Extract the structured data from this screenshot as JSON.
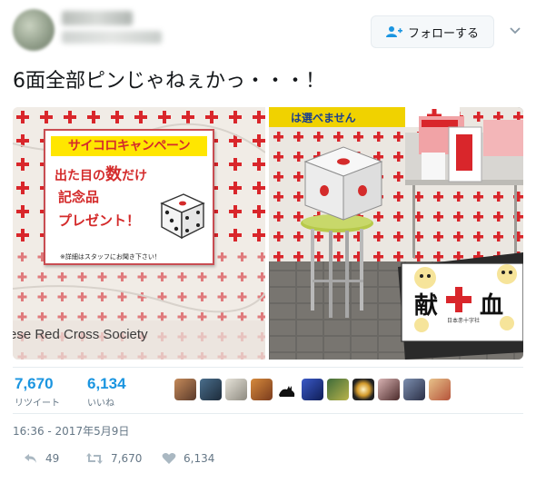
{
  "header": {
    "follow_label": "フォローする"
  },
  "tweet": {
    "text": "6面全部ピンじゃねぇかっ・・・！"
  },
  "media": {
    "left_photo": {
      "sign_title": "サイコロキャンペーン",
      "sign_line1_a": "出た目の",
      "sign_line1_b": "数",
      "sign_line1_c": "だけ",
      "sign_line2": "記念品",
      "sign_line3": "プレゼント！",
      "sign_note": "※詳細はスタッフにお聞き下さい！",
      "banner_text": "ese Red Cross Society"
    },
    "right_photo": {
      "top_banner": "は選べません",
      "sign_kanji_left": "献",
      "sign_kanji_right": "血",
      "sign_caption": "日本赤十字社"
    }
  },
  "stats": {
    "retweets_count": "7,670",
    "retweets_label": "リツイート",
    "likes_count": "6,134",
    "likes_label": "いいね"
  },
  "timestamp": "16:36 - 2017年5月9日",
  "actions": {
    "reply_count": "49",
    "retweet_count": "7,670",
    "like_count": "6,134"
  },
  "colors": {
    "accent": "#1b95e0",
    "red_cross": "#d9262b",
    "muted": "#657786"
  }
}
